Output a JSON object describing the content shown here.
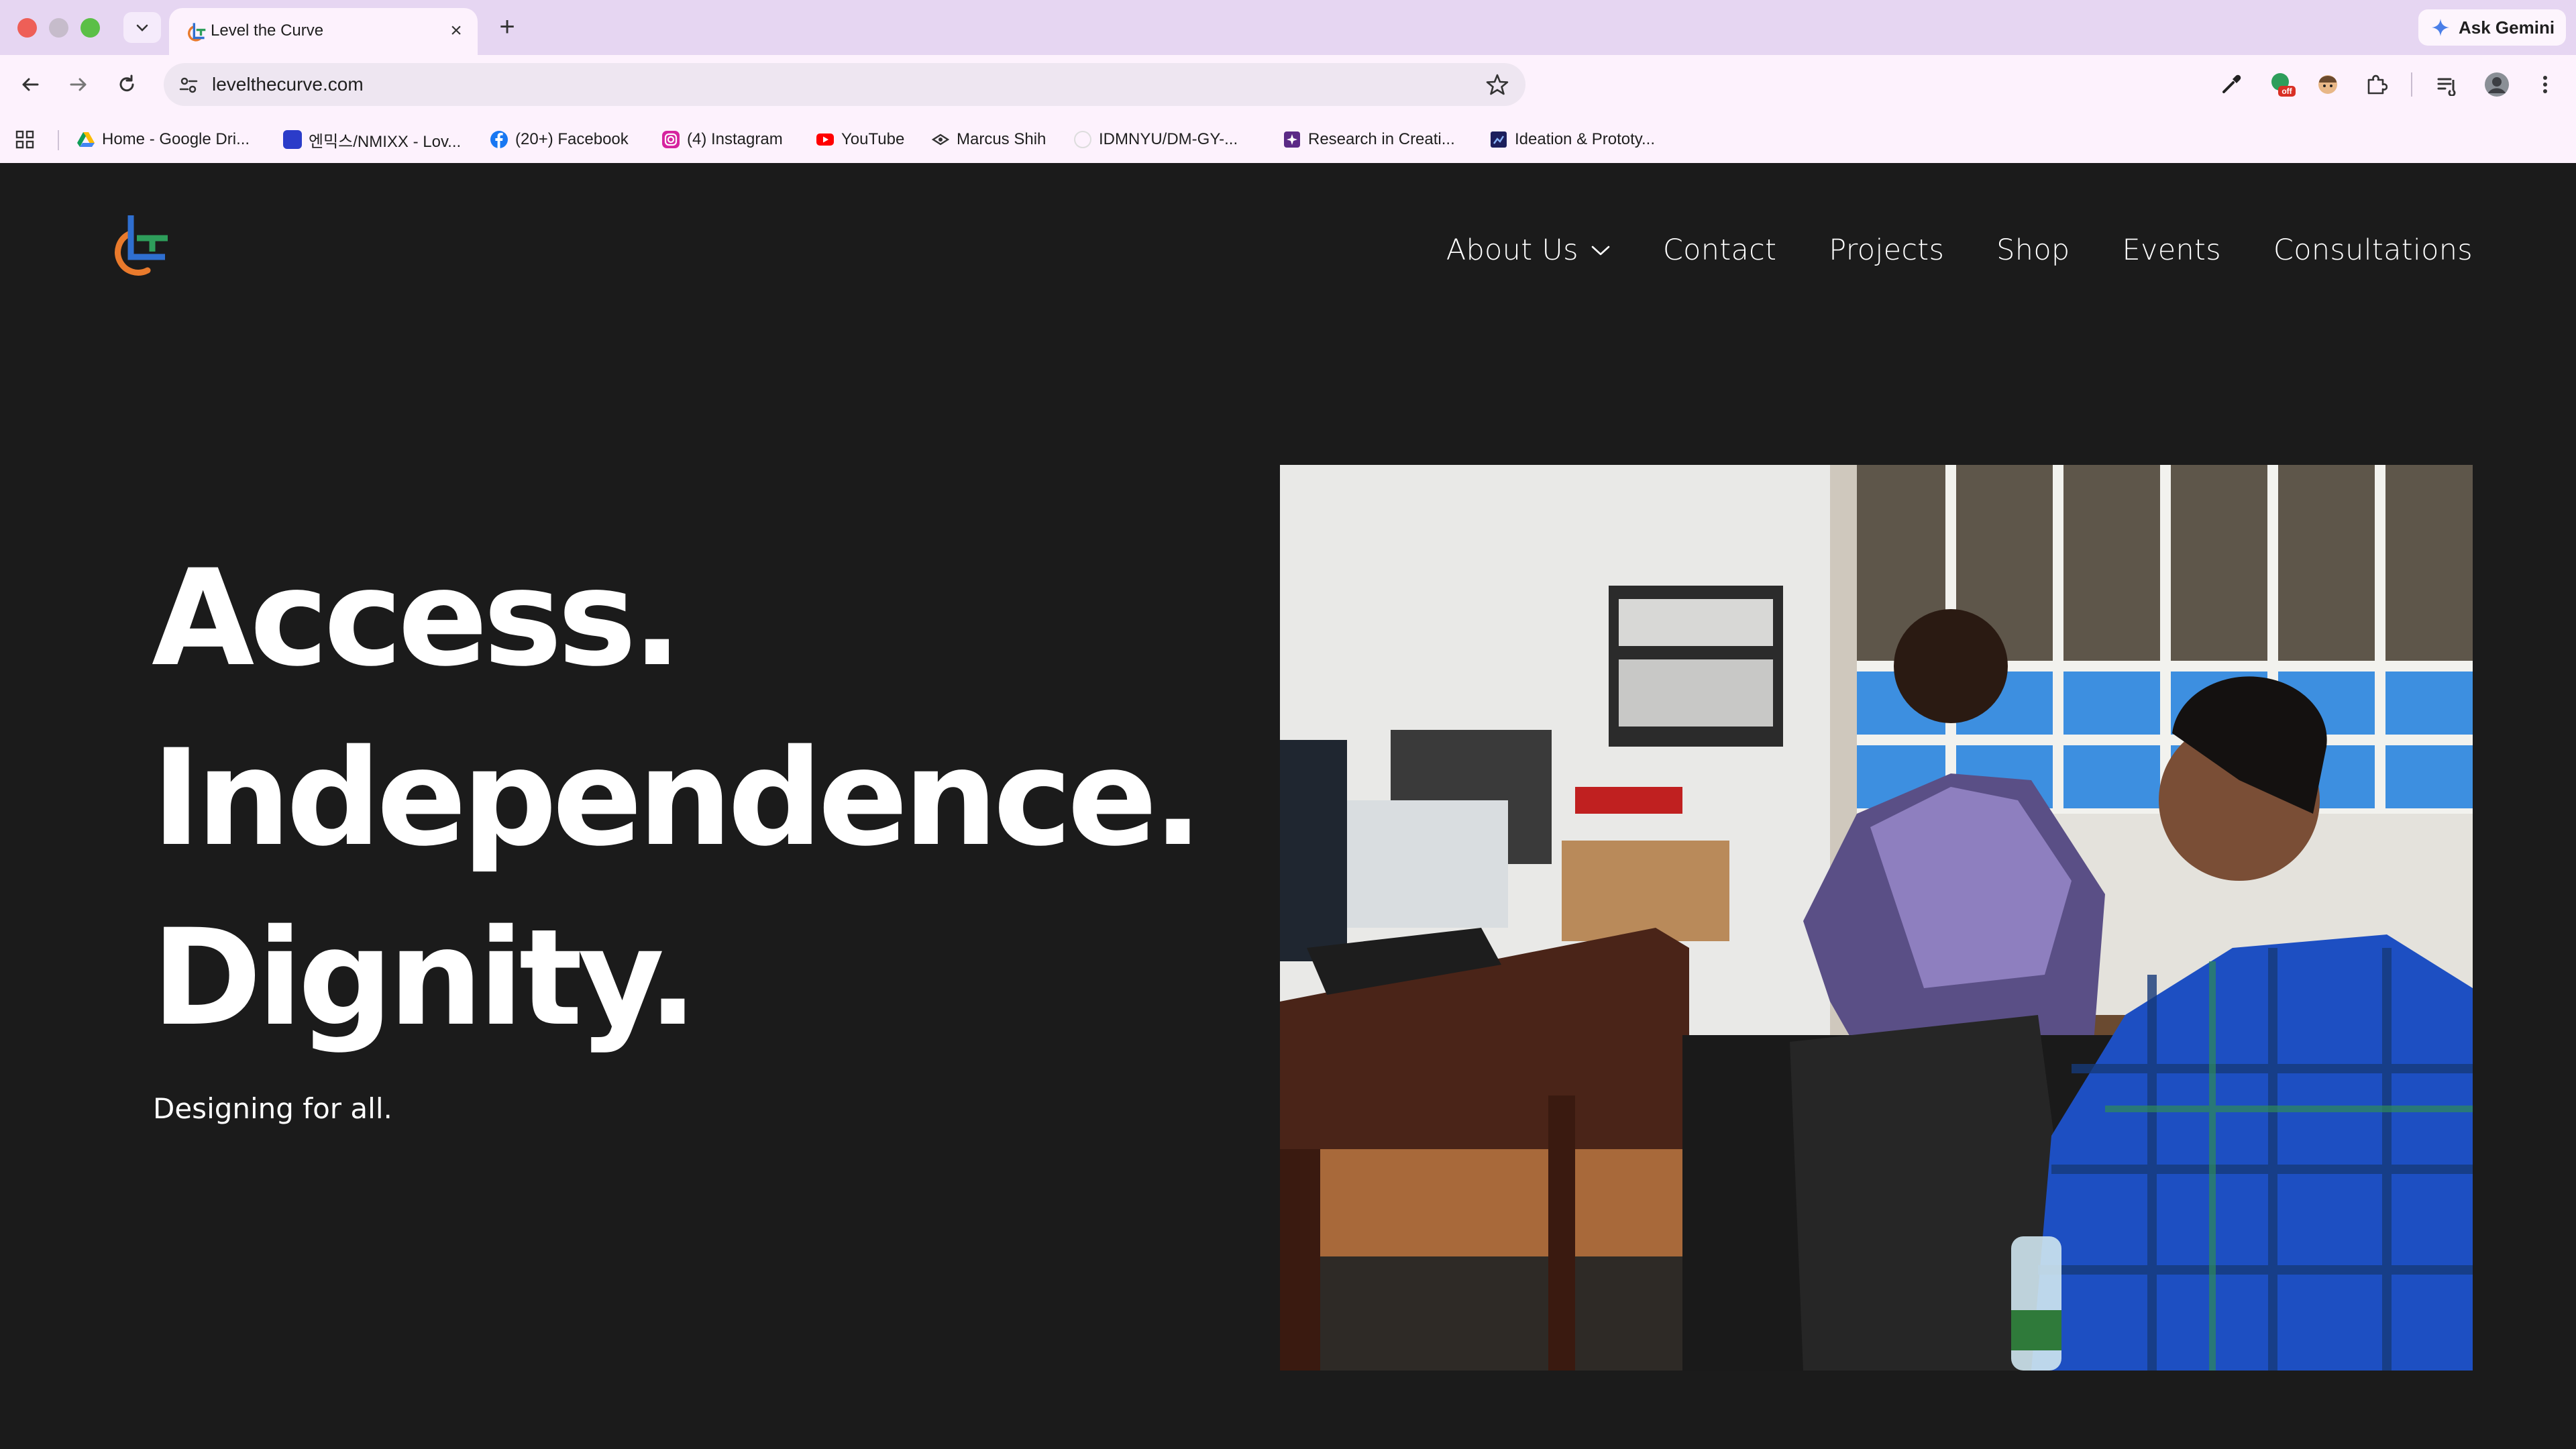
{
  "browser": {
    "tab": {
      "title": "Level the Curve",
      "close_glyph": "×"
    },
    "new_tab_glyph": "+",
    "gemini_label": "Ask Gemini",
    "url": "levelthecurve.com",
    "bookmarks": [
      {
        "label": "Home - Google Dri...",
        "icon": "google-drive-icon"
      },
      {
        "label": "엔믹스/NMIXX - Lov...",
        "icon": "bookmark-blue-icon"
      },
      {
        "label": "(20+) Facebook",
        "icon": "facebook-icon"
      },
      {
        "label": "(4) Instagram",
        "icon": "instagram-icon"
      },
      {
        "label": "YouTube",
        "icon": "youtube-icon"
      },
      {
        "label": "Marcus Shih",
        "icon": "marcus-icon"
      },
      {
        "label": "IDMNYU/DM-GY-...",
        "icon": "github-icon"
      },
      {
        "label": "Research in Creati...",
        "icon": "research-icon"
      },
      {
        "label": "Ideation & Prototy...",
        "icon": "ideation-icon"
      }
    ],
    "extension_badge": "off"
  },
  "site": {
    "nav": {
      "items": [
        "About Us",
        "Contact",
        "Projects",
        "Shop",
        "Events",
        "Consultations"
      ]
    },
    "hero": {
      "headline": [
        "Access.",
        "Independence.",
        "Dignity."
      ],
      "tagline": "Designing for all."
    }
  },
  "colors": {
    "page_bg": "#1b1b1b",
    "text": "#ffffff",
    "chrome_tabstrip": "#e6d6f2",
    "chrome_toolbar": "#fdf2fd",
    "logo_orange": "#e97a2c",
    "logo_blue": "#2f6fd0",
    "logo_green": "#2e9e5b"
  }
}
